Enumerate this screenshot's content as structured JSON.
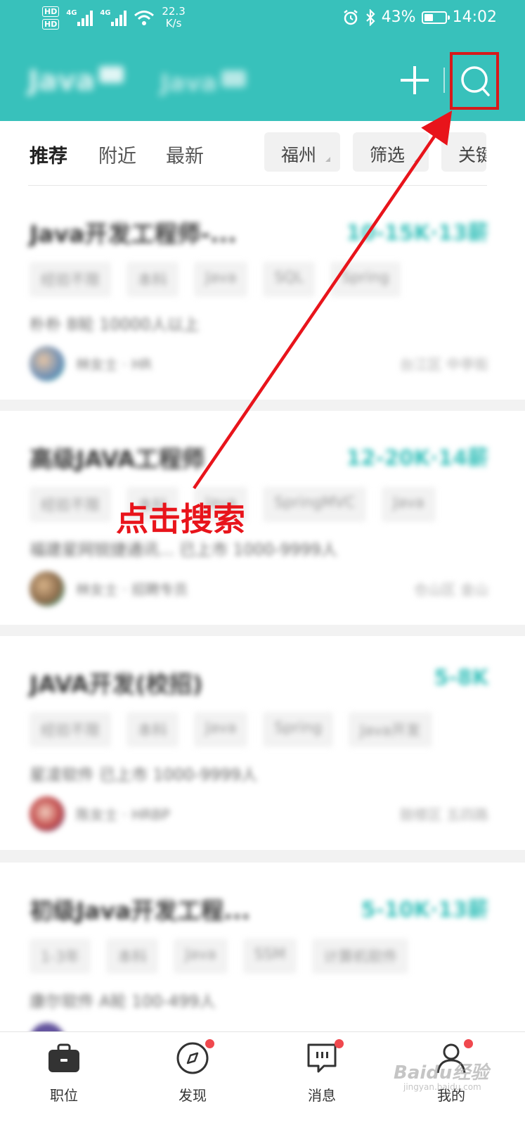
{
  "status_bar": {
    "hd1": "HD",
    "hd2": "HD",
    "net1": "4G",
    "net2": "4G",
    "speed_value": "22.3",
    "speed_unit": "K/s",
    "battery": "43%",
    "battery_level": 0.43,
    "time": "14:02"
  },
  "header": {
    "tabs": [
      {
        "label": "Java",
        "badge": ""
      },
      {
        "label": "Java",
        "badge": ""
      }
    ],
    "add_icon": "plus-icon",
    "search_icon": "search-icon",
    "accent_color": "#38c1bb"
  },
  "filter_bar": {
    "tabs": [
      "推荐",
      "附近",
      "最新"
    ],
    "active_tab": 0,
    "city": "福州",
    "filter": "筛选",
    "keyword": "关键"
  },
  "jobs": [
    {
      "title": "Java开发工程师-...",
      "salary": "10-15K·13薪",
      "tags": [
        "经验不限",
        "本科",
        "Java",
        "SQL",
        "Spring"
      ],
      "company": "朴朴 B轮 10000人以上",
      "hr": "林女士 · HR",
      "location": "台江区 中亭街"
    },
    {
      "title": "高级JAVA工程师",
      "salary": "12-20K·14薪",
      "tags": [
        "经验不限",
        "本科",
        "Java",
        "SpringMVC",
        "Java"
      ],
      "company": "福建星网锐捷通讯... 已上市 1000-9999人",
      "hr": "林女士 · 招聘专员",
      "location": "仓山区 金山"
    },
    {
      "title": "JAVA开发(校招)",
      "salary": "5-8K",
      "tags": [
        "经验不限",
        "本科",
        "Java",
        "Spring",
        "Java开发"
      ],
      "company": "星凌软件 已上市 1000-9999人",
      "hr": "陈女士 · HRBP",
      "location": "鼓楼区 五四路"
    },
    {
      "title": "初级Java开发工程...",
      "salary": "5-10K·13薪",
      "tags": [
        "1-3年",
        "本科",
        "Java",
        "SSM",
        "计算机软件"
      ],
      "company": "康尔软件 A轮 100-499人",
      "hr": "",
      "location": ""
    }
  ],
  "annotation": {
    "text": "点击搜索",
    "color": "#e8141b"
  },
  "bottom_nav": [
    {
      "label": "职位",
      "icon": "briefcase-icon",
      "dot": false
    },
    {
      "label": "发现",
      "icon": "compass-icon",
      "dot": true
    },
    {
      "label": "消息",
      "icon": "chat-icon",
      "dot": true
    },
    {
      "label": "我的",
      "icon": "person-icon",
      "dot": true
    }
  ],
  "watermark": {
    "brand": "Baidu经验",
    "url": "jingyan.baidu.com"
  }
}
